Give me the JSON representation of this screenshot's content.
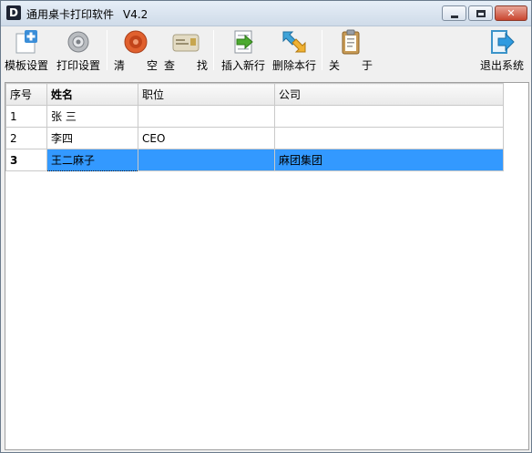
{
  "window": {
    "app_icon": "D",
    "title": "通用桌卡打印软件",
    "version": "V4.2",
    "minimize_icon": "minimize-icon",
    "maximize_icon": "maximize-icon",
    "close_icon": "close-icon"
  },
  "toolbar": {
    "template_settings": "模板设置",
    "print_settings": "打印设置",
    "clear": "清　　空",
    "find": "查　　找",
    "insert_row": "插入新行",
    "delete_row": "删除本行",
    "about": "关　　于",
    "exit": "退出系统"
  },
  "grid": {
    "columns": [
      "序号",
      "姓名",
      "职位",
      "公司"
    ],
    "rows": [
      {
        "no": "1",
        "name": "张  三",
        "title": "",
        "company": ""
      },
      {
        "no": "2",
        "name": "李四",
        "title": "CEO",
        "company": ""
      },
      {
        "no": "3",
        "name": "王二麻子",
        "title": "",
        "company": "麻团集团"
      }
    ],
    "selected_row": 3
  },
  "colors": {
    "selection": "#3399ff",
    "title_bar": "#cfdbe9",
    "close_button": "#c9452e"
  }
}
